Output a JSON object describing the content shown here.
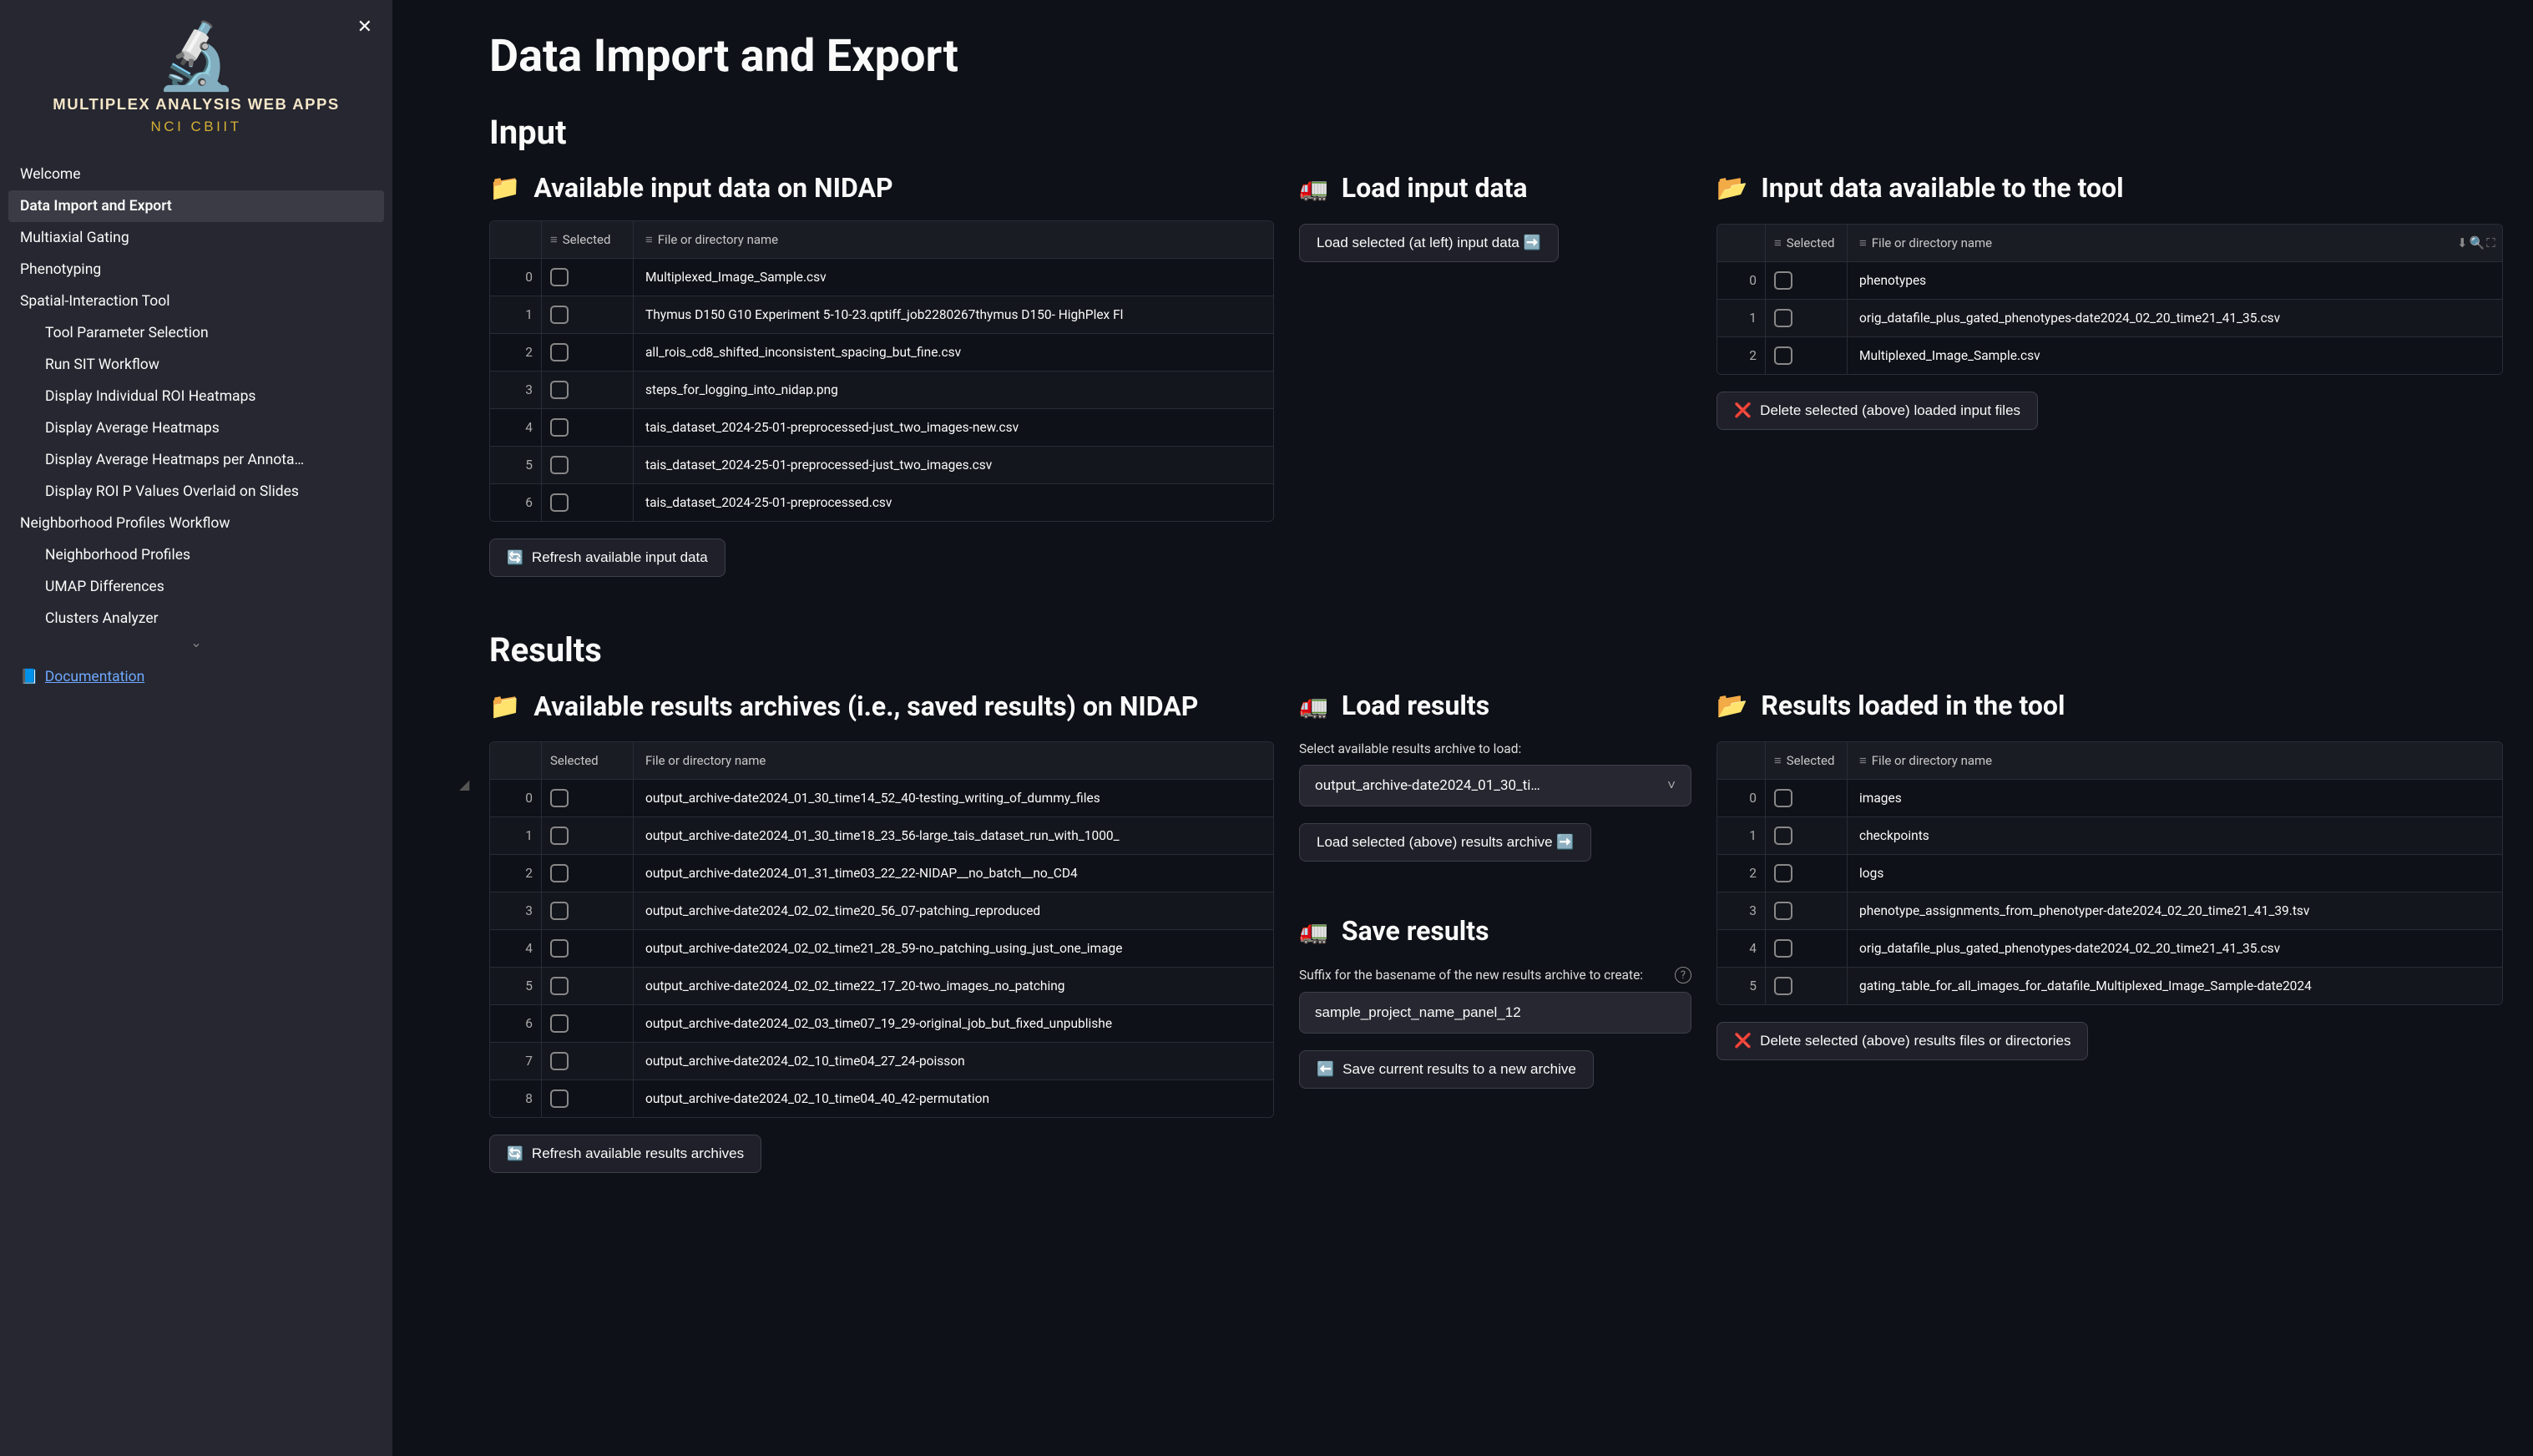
{
  "brand": {
    "title": "MULTIPLEX ANALYSIS WEB APPS",
    "subtitle": "NCI CBIIT"
  },
  "sidebar": {
    "items": [
      {
        "label": "Welcome",
        "active": false,
        "sub": false
      },
      {
        "label": "Data Import and Export",
        "active": true,
        "sub": false
      },
      {
        "label": "Multiaxial Gating",
        "active": false,
        "sub": false
      },
      {
        "label": "Phenotyping",
        "active": false,
        "sub": false
      },
      {
        "label": "Spatial-Interaction Tool",
        "active": false,
        "sub": false
      },
      {
        "label": "Tool Parameter Selection",
        "active": false,
        "sub": true
      },
      {
        "label": "Run SIT Workflow",
        "active": false,
        "sub": true
      },
      {
        "label": "Display Individual ROI Heatmaps",
        "active": false,
        "sub": true
      },
      {
        "label": "Display Average Heatmaps",
        "active": false,
        "sub": true
      },
      {
        "label": "Display Average Heatmaps per Annota…",
        "active": false,
        "sub": true
      },
      {
        "label": "Display ROI P Values Overlaid on Slides",
        "active": false,
        "sub": true
      },
      {
        "label": "Neighborhood Profiles Workflow",
        "active": false,
        "sub": false
      },
      {
        "label": "Neighborhood Profiles",
        "active": false,
        "sub": true
      },
      {
        "label": "UMAP Differences",
        "active": false,
        "sub": true
      },
      {
        "label": "Clusters Analyzer",
        "active": false,
        "sub": true
      }
    ],
    "doc_label": "Documentation"
  },
  "page": {
    "title": "Data Import and Export",
    "input_h": "Input",
    "results_h": "Results"
  },
  "input": {
    "available": {
      "heading": "Available input data on NIDAP",
      "col_selected": "Selected",
      "col_file": "File or directory name",
      "rows": [
        {
          "idx": "0",
          "file": "Multiplexed_Image_Sample.csv"
        },
        {
          "idx": "1",
          "file": "Thymus D150 G10 Experiment 5-10-23.qptiff_job2280267thymus D150- HighPlex Fl"
        },
        {
          "idx": "2",
          "file": "all_rois_cd8_shifted_inconsistent_spacing_but_fine.csv"
        },
        {
          "idx": "3",
          "file": "steps_for_logging_into_nidap.png"
        },
        {
          "idx": "4",
          "file": "tais_dataset_2024-25-01-preprocessed-just_two_images-new.csv"
        },
        {
          "idx": "5",
          "file": "tais_dataset_2024-25-01-preprocessed-just_two_images.csv"
        },
        {
          "idx": "6",
          "file": "tais_dataset_2024-25-01-preprocessed.csv"
        }
      ],
      "refresh_btn": "Refresh available input data"
    },
    "load": {
      "heading": "Load input data",
      "load_btn": "Load selected (at left) input data ➡️"
    },
    "tool": {
      "heading": "Input data available to the tool",
      "col_selected": "Selected",
      "col_file": "File or directory name",
      "rows": [
        {
          "idx": "0",
          "file": "phenotypes"
        },
        {
          "idx": "1",
          "file": "orig_datafile_plus_gated_phenotypes-date2024_02_20_time21_41_35.csv"
        },
        {
          "idx": "2",
          "file": "Multiplexed_Image_Sample.csv"
        }
      ],
      "delete_btn": "Delete selected (above) loaded input files"
    }
  },
  "results": {
    "available": {
      "heading": "Available results archives (i.e., saved results) on NIDAP",
      "col_selected": "Selected",
      "col_file": "File or directory name",
      "rows": [
        {
          "idx": "0",
          "file": "output_archive-date2024_01_30_time14_52_40-testing_writing_of_dummy_files"
        },
        {
          "idx": "1",
          "file": "output_archive-date2024_01_30_time18_23_56-large_tais_dataset_run_with_1000_"
        },
        {
          "idx": "2",
          "file": "output_archive-date2024_01_31_time03_22_22-NIDAP__no_batch__no_CD4"
        },
        {
          "idx": "3",
          "file": "output_archive-date2024_02_02_time20_56_07-patching_reproduced"
        },
        {
          "idx": "4",
          "file": "output_archive-date2024_02_02_time21_28_59-no_patching_using_just_one_image"
        },
        {
          "idx": "5",
          "file": "output_archive-date2024_02_02_time22_17_20-two_images_no_patching"
        },
        {
          "idx": "6",
          "file": "output_archive-date2024_02_03_time07_19_29-original_job_but_fixed_unpublishe"
        },
        {
          "idx": "7",
          "file": "output_archive-date2024_02_10_time04_27_24-poisson"
        },
        {
          "idx": "8",
          "file": "output_archive-date2024_02_10_time04_40_42-permutation"
        }
      ],
      "refresh_btn": "Refresh available results archives"
    },
    "load": {
      "heading": "Load results",
      "select_label": "Select available results archive to load:",
      "select_value": "output_archive-date2024_01_30_ti…",
      "load_btn": "Load selected (above) results archive ➡️"
    },
    "save": {
      "heading": "Save results",
      "suffix_label": "Suffix for the basename of the new results archive to create:",
      "suffix_value": "sample_project_name_panel_12",
      "save_btn": "Save current results to a new archive"
    },
    "loaded": {
      "heading": "Results loaded in the tool",
      "col_selected": "Selected",
      "col_file": "File or directory name",
      "rows": [
        {
          "idx": "0",
          "file": "images"
        },
        {
          "idx": "1",
          "file": "checkpoints"
        },
        {
          "idx": "2",
          "file": "logs"
        },
        {
          "idx": "3",
          "file": "phenotype_assignments_from_phenotyper-date2024_02_20_time21_41_39.tsv"
        },
        {
          "idx": "4",
          "file": "orig_datafile_plus_gated_phenotypes-date2024_02_20_time21_41_35.csv"
        },
        {
          "idx": "5",
          "file": "gating_table_for_all_images_for_datafile_Multiplexed_Image_Sample-date2024"
        }
      ],
      "delete_btn": "Delete selected (above) results files or directories"
    }
  }
}
